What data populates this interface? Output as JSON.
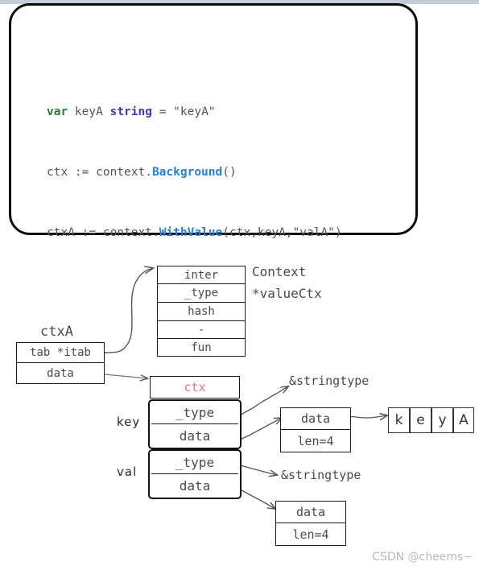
{
  "page": {
    "watermark": "CSDN @cheems~",
    "background": "#ffffff",
    "top_strip_color": "#c6ccd8"
  },
  "code_card": {
    "border_color": "#0a0a0a",
    "lines": [
      {
        "id": "line1",
        "tokens": [
          {
            "text": "var",
            "style": "kw-var"
          },
          {
            "text": " keyA ",
            "style": "plain"
          },
          {
            "text": "string",
            "style": "kw-type"
          },
          {
            "text": " = \"keyA\"",
            "style": "plain"
          }
        ],
        "plain": "var keyA string = \"keyA\""
      },
      {
        "id": "line2",
        "tokens": [
          {
            "text": "ctx := context.",
            "style": "plain"
          },
          {
            "text": "Background",
            "style": "fn"
          },
          {
            "text": "()",
            "style": "plain"
          }
        ],
        "plain": "ctx := context.Background()"
      },
      {
        "id": "line3",
        "tokens": [
          {
            "text": "ctxA := context.",
            "style": "plain"
          },
          {
            "text": "WithValue",
            "style": "fn"
          },
          {
            "text": "(ctx,keyA,\"valA\")",
            "style": "plain"
          }
        ],
        "plain": "ctxA := context.WithValue(ctx,keyA,\"valA\")"
      }
    ],
    "colors": {
      "keyword": "#2a7a3e",
      "type": "#3b3bb5",
      "function": "#2a7fd4",
      "plain": "#4d4d4d"
    }
  },
  "diagram": {
    "itab_table": {
      "name": "itab-table",
      "rows": [
        "inter",
        "_type",
        "hash",
        "-",
        "fun"
      ]
    },
    "itab_labels": {
      "line1": "Context",
      "line2": "*valueCtx"
    },
    "ctxa": {
      "title": "ctxA",
      "rows": [
        "tab *itab",
        "data"
      ]
    },
    "valuectx": {
      "header": "ctx",
      "header_color": "#e8708a",
      "key_label": "key",
      "val_label": "val",
      "key_rows": [
        "_type",
        "data"
      ],
      "val_rows": [
        "_type",
        "data"
      ]
    },
    "key_type_label": "&stringtype",
    "key_string_header": {
      "rows": [
        "data",
        "len=4"
      ]
    },
    "key_chars": [
      "k",
      "e",
      "y",
      "A"
    ],
    "val_type_label": "&stringtype",
    "val_string_header": {
      "rows": [
        "data",
        "len=4"
      ]
    }
  }
}
